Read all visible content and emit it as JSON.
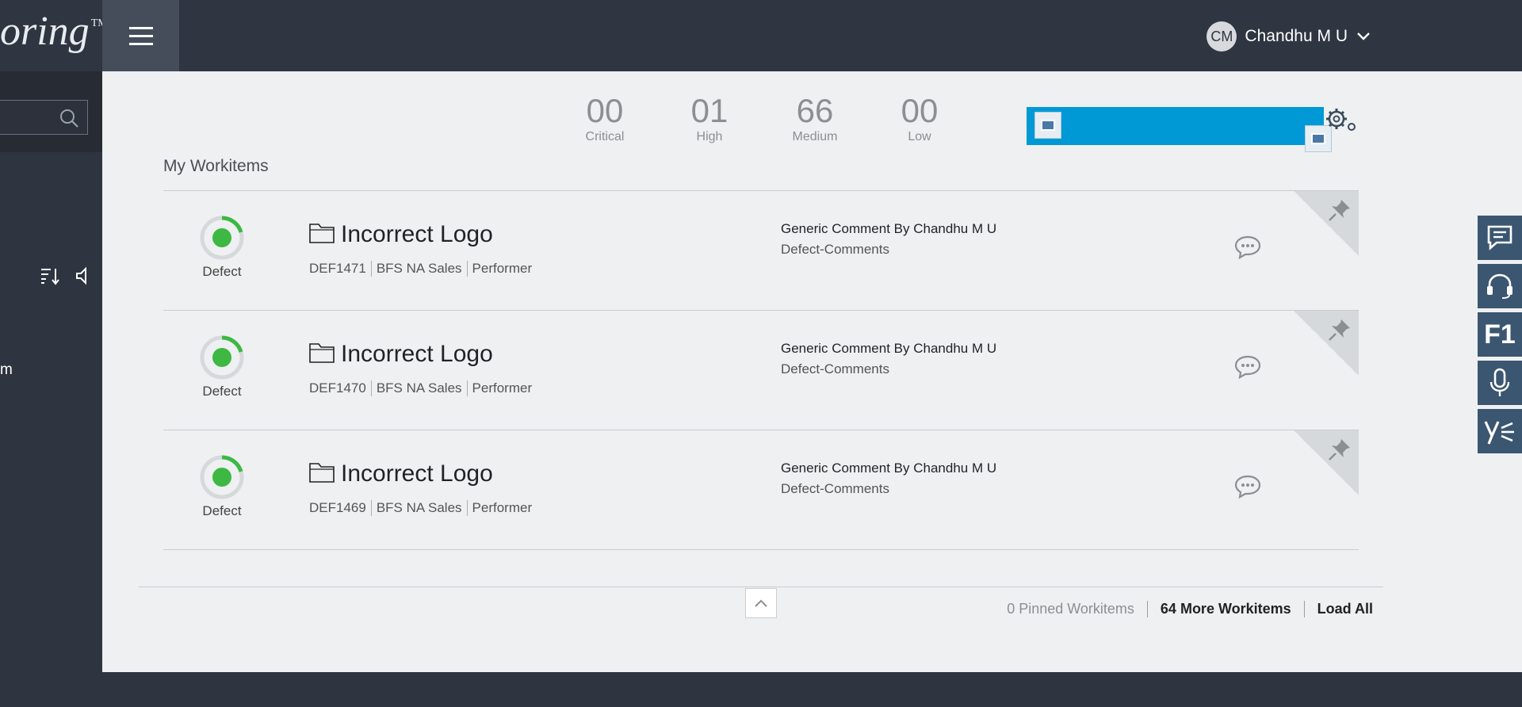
{
  "header": {
    "brand": "oring",
    "brand_mark": "TM",
    "user": {
      "initials": "CM",
      "name": "Chandhu M U"
    }
  },
  "sidebar": {
    "partial_label": "m"
  },
  "counts": [
    {
      "value": "00",
      "label": "Critical"
    },
    {
      "value": "01",
      "label": "High"
    },
    {
      "value": "66",
      "label": "Medium"
    },
    {
      "value": "00",
      "label": "Low"
    }
  ],
  "section_title": "My Workitems",
  "workitems": [
    {
      "type": "Defect",
      "title": "Incorrect Logo",
      "id": "DEF1471",
      "team": "BFS NA Sales",
      "role": "Performer",
      "comment_by": "Generic Comment By Chandhu M U",
      "comment_cat": "Defect-Comments"
    },
    {
      "type": "Defect",
      "title": "Incorrect Logo",
      "id": "DEF1470",
      "team": "BFS NA Sales",
      "role": "Performer",
      "comment_by": "Generic Comment By Chandhu M U",
      "comment_cat": "Defect-Comments"
    },
    {
      "type": "Defect",
      "title": "Incorrect Logo",
      "id": "DEF1469",
      "team": "BFS NA Sales",
      "role": "Performer",
      "comment_by": "Generic Comment By Chandhu M U",
      "comment_cat": "Defect-Comments"
    }
  ],
  "footer": {
    "pinned": "0 Pinned Workitems",
    "more": "64 More Workitems",
    "load_all": "Load All"
  },
  "right_tools": {
    "f1_label": "F1"
  },
  "colors": {
    "accent_blue": "#0099d6",
    "status_green": "#3db843",
    "header_bg": "#2f3541",
    "tool_bg": "#3b5670"
  }
}
